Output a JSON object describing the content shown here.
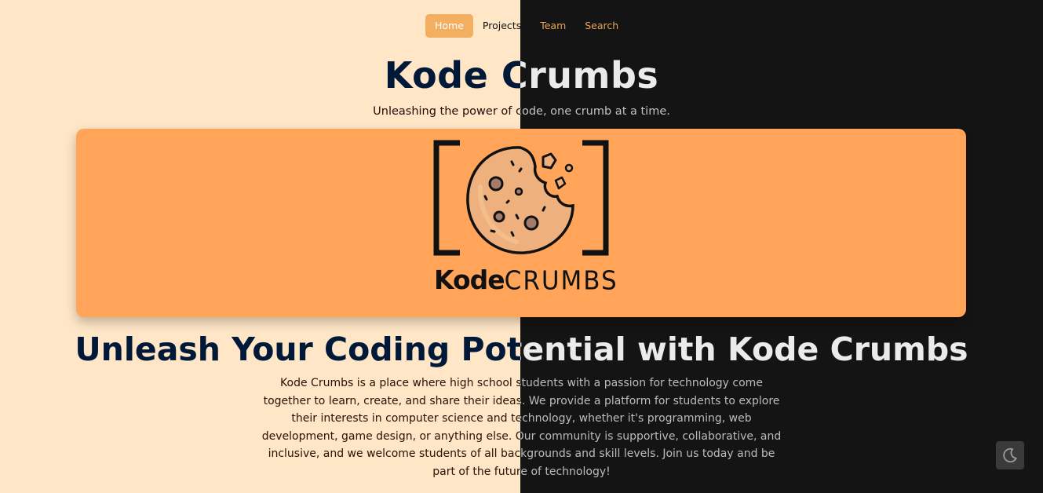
{
  "nav": {
    "items": [
      {
        "label": "Home",
        "state": "active"
      },
      {
        "label": "Projects",
        "state": "default"
      },
      {
        "label": "Team",
        "state": "accent"
      },
      {
        "label": "Search",
        "state": "accent"
      }
    ]
  },
  "header": {
    "title": "Kode Crumbs",
    "tagline": "Unleashing the power of code, one crumb at a time."
  },
  "hero": {
    "logo_icon": "cookie-in-brackets-icon",
    "logo_word_bold": "Kode",
    "logo_word_light": "CRUMBS"
  },
  "main": {
    "headline": "Unleash Your Coding Potential with Kode Crumbs",
    "description": "Kode Crumbs is a place where high school students with a passion for technology come together to learn, create, and share their ideas. We provide a platform for students to explore their interests in computer science and technology, whether it's programming, web development, game design, or anything else. Our community is supportive, collaborative, and inclusive, and we welcome students of all backgrounds and skill levels. Join us today and be part of the future of technology!"
  },
  "controls": {
    "theme_toggle_icon": "moon-icon"
  },
  "colors": {
    "left_bg": "#ffe6c7",
    "right_bg": "#141414",
    "hero_bg": "#ffa458",
    "accent": "#f3ae5f"
  }
}
